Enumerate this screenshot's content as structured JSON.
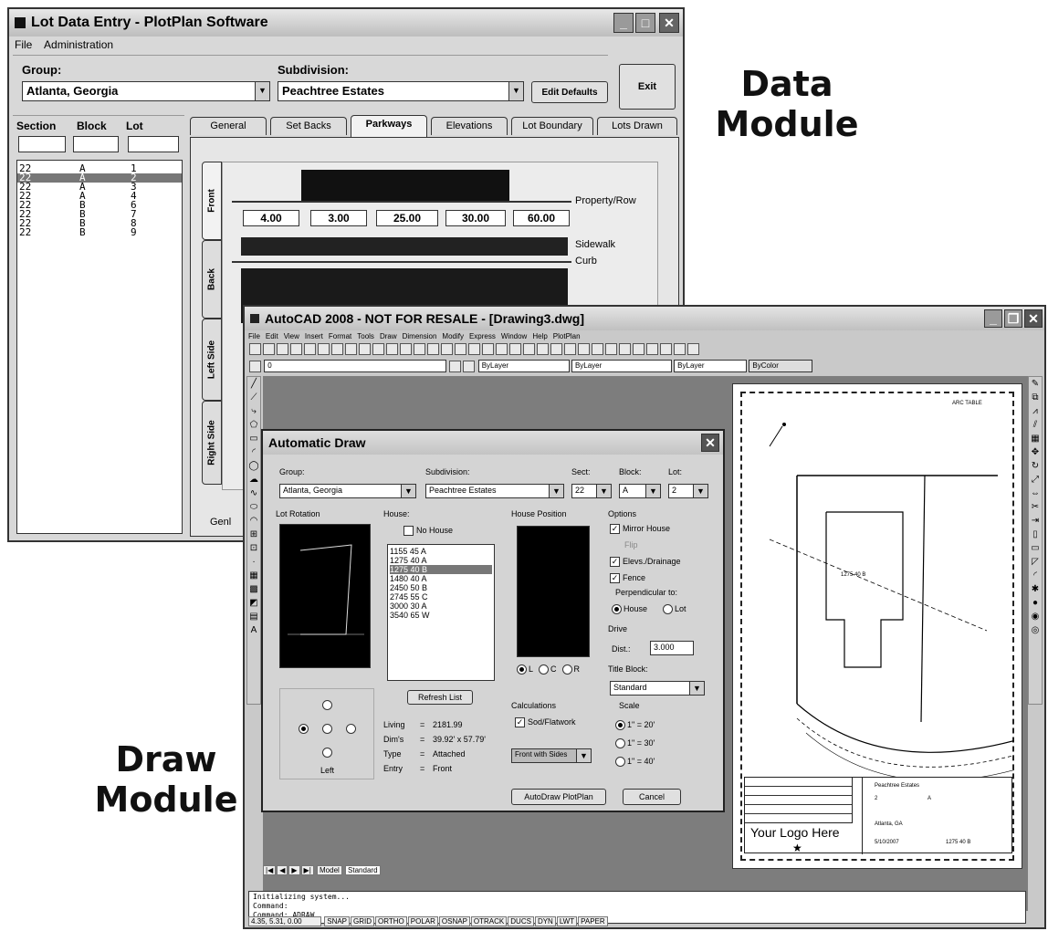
{
  "data_window": {
    "title": "Lot Data Entry - PlotPlan Software",
    "menu": [
      "File",
      "Administration"
    ],
    "group_label": "Group:",
    "group_value": "Atlanta, Georgia",
    "subdivision_label": "Subdivision:",
    "subdivision_value": "Peachtree Estates",
    "edit_defaults": "Edit Defaults",
    "exit": "Exit",
    "col_headers": [
      "Section",
      "Block",
      "Lot"
    ],
    "lots": [
      {
        "section": "22",
        "block": "A",
        "lot": "1"
      },
      {
        "section": "22",
        "block": "A",
        "lot": "2"
      },
      {
        "section": "22",
        "block": "A",
        "lot": "3"
      },
      {
        "section": "22",
        "block": "A",
        "lot": "4"
      },
      {
        "section": "22",
        "block": "B",
        "lot": "6"
      },
      {
        "section": "22",
        "block": "B",
        "lot": "7"
      },
      {
        "section": "22",
        "block": "B",
        "lot": "8"
      },
      {
        "section": "22",
        "block": "B",
        "lot": "9"
      }
    ],
    "selected_lot_index": 1,
    "tabs": [
      "General",
      "Set Backs",
      "Parkways",
      "Elevations",
      "Lot Boundary",
      "Lots Drawn"
    ],
    "active_tab": "Parkways",
    "side_tabs": [
      "Front",
      "Back",
      "Left Side",
      "Right Side"
    ],
    "parkway_values": [
      "4.00",
      "3.00",
      "25.00",
      "30.00",
      "60.00"
    ],
    "parkway_labels": [
      "Property/Row",
      "Sidewalk",
      "Curb"
    ],
    "partial_tab": "Genl"
  },
  "module_labels": {
    "data": [
      "Data",
      "Module"
    ],
    "draw": [
      "Draw",
      "Module"
    ]
  },
  "autocad": {
    "title": "AutoCAD 2008 - NOT FOR RESALE - [Drawing3.dwg]",
    "menu": [
      "File",
      "Edit",
      "View",
      "Insert",
      "Format",
      "Tools",
      "Draw",
      "Dimension",
      "Modify",
      "Express",
      "Window",
      "Help",
      "PlotPlan"
    ],
    "layer_value": "0",
    "bylayer": [
      "ByLayer",
      "ByLayer",
      "ByLayer",
      "ByColor"
    ],
    "tabs": [
      "Model",
      "Standard"
    ],
    "command_lines": [
      "Initializing system...",
      "Command:",
      "Command: ADRAW"
    ],
    "coords": "4.35, 5.31, 0.00",
    "status_buttons": [
      "SNAP",
      "GRID",
      "ORTHO",
      "POLAR",
      "OSNAP",
      "OTRACK",
      "DUCS",
      "DYN",
      "LWT",
      "PAPER"
    ]
  },
  "auto_draw": {
    "title": "Automatic Draw",
    "group_label": "Group:",
    "group_value": "Atlanta, Georgia",
    "subdivision_label": "Subdivision:",
    "subdivision_value": "Peachtree Estates",
    "sect_label": "Sect:",
    "sect_value": "22",
    "block_label": "Block:",
    "block_value": "A",
    "lot_label": "Lot:",
    "lot_value": "2",
    "lot_rotation_label": "Lot Rotation",
    "rotation_value": "Left",
    "house_label": "House:",
    "no_house": "No House",
    "houses": [
      "1155 45 A",
      "1275 40 A",
      "1275 40 B",
      "1480 40 A",
      "2450 50 B",
      "2745 55 C",
      "3000 30 A",
      "3540 65 W"
    ],
    "selected_house_index": 2,
    "refresh_list": "Refresh List",
    "info": [
      {
        "k": "Living",
        "v": "2181.99"
      },
      {
        "k": "Dim's",
        "v": "39.92' x 57.79'"
      },
      {
        "k": "Type",
        "v": "Attached"
      },
      {
        "k": "Entry",
        "v": "Front"
      }
    ],
    "house_position_label": "House Position",
    "position_options": [
      "L",
      "C",
      "R"
    ],
    "position_selected": "L",
    "calculations_label": "Calculations",
    "sod_flatwork": "Sod/Flatwork",
    "front_select": "Front with Sides",
    "options_label": "Options",
    "mirror_house": "Mirror House",
    "flip": "Flip",
    "elevs_drainage": "Elevs./Drainage",
    "fence": "Fence",
    "perpendicular_to": "Perpendicular to:",
    "perp_options": [
      "House",
      "Lot"
    ],
    "drive_label": "Drive",
    "dist_label": "Dist.:",
    "dist_value": "3.000",
    "title_block_label": "Title Block:",
    "title_block_value": "Standard",
    "scale_label": "Scale",
    "scales": [
      "1\" = 20'",
      "1\" = 30'",
      "1\" = 40'"
    ],
    "scale_selected": "1\" = 20'",
    "autodraw_btn": "AutoDraw PlotPlan",
    "cancel_btn": "Cancel"
  },
  "drawing": {
    "arc_table": "ARC TABLE",
    "house_label": "1275 40 B",
    "logo_text": "Your Logo Here",
    "tb_subdivision": "Peachtree Estates",
    "tb_section": "2",
    "tb_block": "A",
    "tb_city": "Atlanta, GA",
    "tb_date": "5/10/2007",
    "tb_house": "1275 40 B"
  }
}
